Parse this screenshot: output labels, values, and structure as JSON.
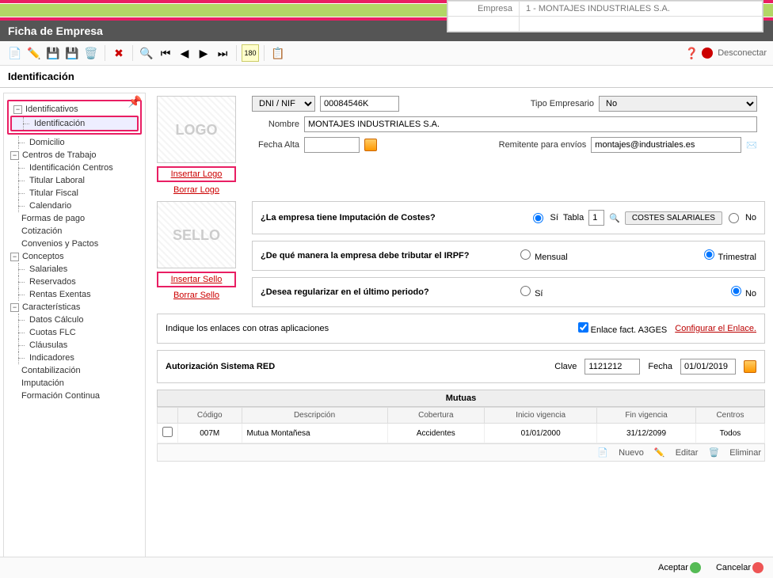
{
  "company": {
    "label": "Empresa",
    "value": "1 - MONTAJES INDUSTRIALES S.A."
  },
  "title": "Ficha de Empresa",
  "disconnect": "Desconectar",
  "section": "Identificación",
  "sidebar": {
    "identificativos": "Identificativos",
    "identificacion": "Identificación",
    "domicilio": "Domicilio",
    "centros": "Centros de Trabajo",
    "id_centros": "Identificación Centros",
    "tit_laboral": "Titular Laboral",
    "tit_fiscal": "Titular Fiscal",
    "calendario": "Calendario",
    "formas_pago": "Formas de pago",
    "cotizacion": "Cotización",
    "convenios": "Convenios y Pactos",
    "conceptos": "Conceptos",
    "salariales": "Salariales",
    "reservados": "Reservados",
    "rentas": "Rentas Exentas",
    "caracteristicas": "Características",
    "datos_calc": "Datos Cálculo",
    "cuotas": "Cuotas FLC",
    "clausulas": "Cláusulas",
    "indicadores": "Indicadores",
    "contab": "Contabilización",
    "imputacion": "Imputación",
    "formacion": "Formación Continua"
  },
  "logo": {
    "placeholder": "LOGO",
    "insert": "Insertar Logo",
    "delete": "Borrar Logo"
  },
  "sello": {
    "placeholder": "SELLO",
    "insert": "Insertar Sello",
    "delete": "Borrar Sello"
  },
  "form": {
    "doc_type": "DNI / NIF",
    "doc_value": "00084546K",
    "tipo_emp_label": "Tipo Empresario",
    "tipo_emp_value": "No",
    "nombre_label": "Nombre",
    "nombre_value": "MONTAJES INDUSTRIALES S.A.",
    "fecha_alta_label": "Fecha Alta",
    "fecha_alta_value": "",
    "remitente_label": "Remitente para envíos",
    "remitente_value": "montajes@industriales.es"
  },
  "panel1": {
    "q": "¿La empresa tiene Imputación de Costes?",
    "si": "Sí",
    "tabla": "Tabla",
    "tabla_val": "1",
    "btn": "COSTES SALARIALES",
    "no": "No"
  },
  "panel2": {
    "q": "¿De qué manera la empresa debe tributar el IRPF?",
    "mensual": "Mensual",
    "trimestral": "Trimestral"
  },
  "panel3": {
    "q": "¿Desea regularizar en el último periodo?",
    "si": "Sí",
    "no": "No"
  },
  "panel4": {
    "q": "Indique los enlaces con otras aplicaciones",
    "chk": "Enlace fact. A3GES",
    "link": "Configurar el Enlace."
  },
  "panel5": {
    "title": "Autorización Sistema RED",
    "clave_label": "Clave",
    "clave_val": "1121212",
    "fecha_label": "Fecha",
    "fecha_val": "01/01/2019"
  },
  "mutuas": {
    "title": "Mutuas",
    "cols": {
      "codigo": "Código",
      "desc": "Descripción",
      "cobertura": "Cobertura",
      "inicio": "Inicio vigencia",
      "fin": "Fin vigencia",
      "centros": "Centros"
    },
    "row": {
      "codigo": "007M",
      "desc": "Mutua Montañesa",
      "cobertura": "Accidentes",
      "inicio": "01/01/2000",
      "fin": "31/12/2099",
      "centros": "Todos"
    },
    "actions": {
      "nuevo": "Nuevo",
      "editar": "Editar",
      "eliminar": "Eliminar"
    }
  },
  "footer": {
    "aceptar": "Aceptar",
    "cancelar": "Cancelar"
  }
}
